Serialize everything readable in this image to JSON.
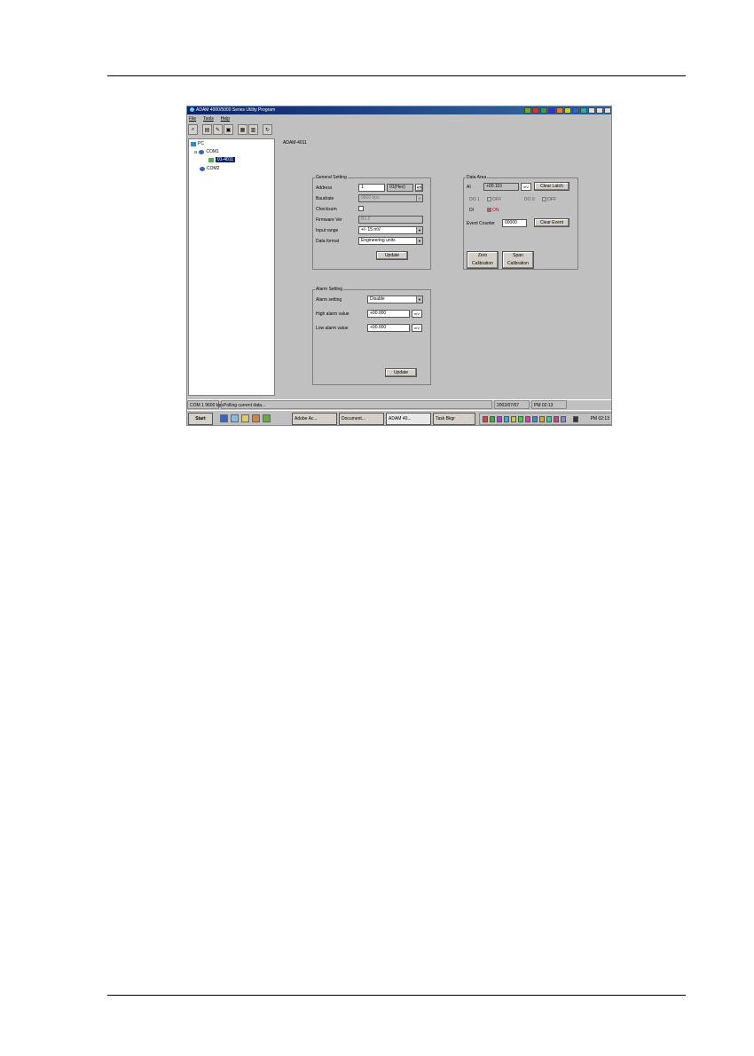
{
  "window": {
    "title": "ADAM 4000/5000 Series Utility Program"
  },
  "menu": [
    "File",
    "Tools",
    "Help"
  ],
  "tree": {
    "root": "PC",
    "com1": "COM1",
    "module": "01-4011",
    "com2": "COM2"
  },
  "node_title": "ADAM-4011",
  "general": {
    "label": "General Setting",
    "address_label": "Address",
    "address_value": "1",
    "address_hex": "01(Hex)",
    "baudrate_label": "Baudrate",
    "baudrate_value": "9600 bps",
    "checksum_label": "Checksum",
    "firmware_label": "Firmware Ver",
    "firmware_value": "B1.2",
    "input_range_label": "Input range",
    "input_range_value": "+/-    15 mV",
    "data_format_label": "Data format",
    "data_format_value": "Engineering units",
    "update_label": "Update"
  },
  "data_area": {
    "label": "Data Area",
    "ai_label": "AI",
    "ai_value": "+00.110",
    "ai_unit": "mV",
    "clear_latch": "Clear Latch",
    "do1_label": "DO 1",
    "do1_state": "OFF",
    "do0_label": "DO 0",
    "do0_state": "OFF",
    "di_label": "DI",
    "di_state": "ON",
    "event_counter_label": "Event Counter",
    "event_counter_value": "00000",
    "clear_event": "Clear Event",
    "zero_cal": "Zero Calibration",
    "span_cal": "Span Calibration"
  },
  "alarm": {
    "label": "Alarm Setting",
    "mode_label": "Alarm setting",
    "mode_value": "Disable",
    "high_label": "High alarm value",
    "high_value": "+00.000",
    "high_unit": "mV",
    "low_label": "Low alarm value",
    "low_value": "+00.000",
    "low_unit": "mV",
    "update_label": "Update"
  },
  "status": {
    "port": "COM 1  9600  bps",
    "message": "Polling current data...",
    "date": "2002/07/07",
    "time": "PM 02:13"
  },
  "taskbar": {
    "start": "Start",
    "tasks": [
      "Adobe Ac...",
      "Document...",
      "ADAM 40...",
      "Task Bkgr"
    ],
    "clock": "PM 02:13"
  }
}
